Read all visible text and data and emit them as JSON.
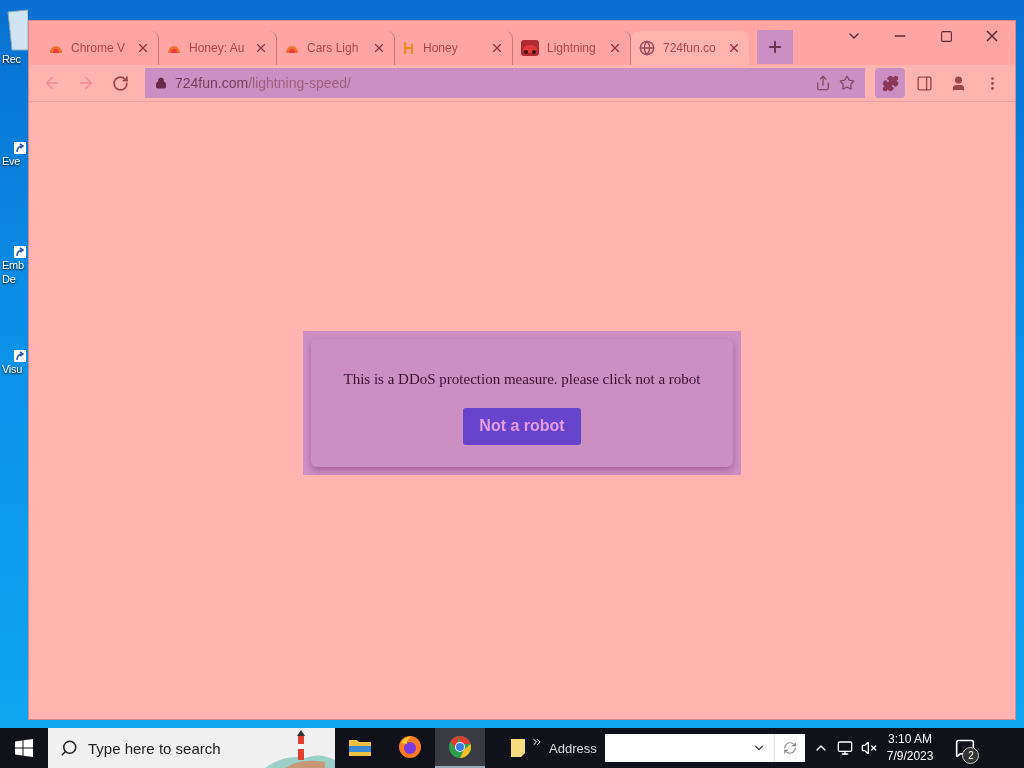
{
  "desktop": {
    "icons": [
      {
        "label": "Rec",
        "kind": "recycle"
      },
      {
        "label": "Eve",
        "kind": "shortcut"
      },
      {
        "label": "Emb De",
        "kind": "shortcut"
      },
      {
        "label": "Visu",
        "kind": "shortcut"
      }
    ]
  },
  "browser": {
    "tabs": [
      {
        "title": "Chrome V",
        "kind": "arc",
        "selected": false
      },
      {
        "title": "Honey: Au",
        "kind": "arc",
        "selected": false
      },
      {
        "title": "Cars Ligh",
        "kind": "arc",
        "selected": false
      },
      {
        "title": "Honey",
        "kind": "letter",
        "selected": false
      },
      {
        "title": "Lightning",
        "kind": "car",
        "selected": false
      },
      {
        "title": "724fun.co",
        "kind": "globe",
        "selected": true
      }
    ],
    "toolbar": {
      "back_disabled": true,
      "forward_disabled": true,
      "url_host": "724fun.com",
      "url_path": "/lightning-speed/"
    }
  },
  "page": {
    "message": "This is a DDoS protection measure. please click not a robot",
    "button": "Not a robot"
  },
  "taskbar": {
    "search_placeholder": "Type here to search",
    "apps": [
      {
        "kind": "explorer",
        "selected": false
      },
      {
        "kind": "firefox",
        "selected": false
      },
      {
        "kind": "chrome",
        "selected": true
      }
    ],
    "address_label": "Address",
    "time": "3:10 AM",
    "date": "7/9/2023",
    "notifications": "2"
  }
}
